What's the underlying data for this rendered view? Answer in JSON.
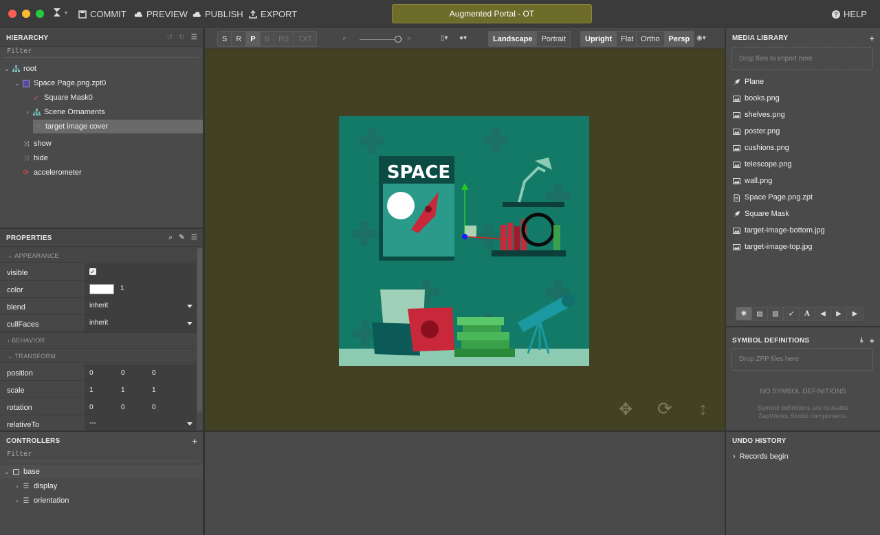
{
  "toolbar": {
    "commit": "COMMIT",
    "preview": "PREVIEW",
    "publish": "PUBLISH",
    "export": "EXPORT",
    "help": "HELP",
    "document_title": "Augmented Portal - OT"
  },
  "hierarchy": {
    "title": "HIERARCHY",
    "filter_placeholder": "Filter",
    "items": [
      {
        "label": "root",
        "icon": "hierarchy-icon"
      },
      {
        "label": "Space Page.png.zpt0",
        "icon": "page-icon"
      },
      {
        "label": "Square Mask0",
        "icon": "rocket-icon"
      },
      {
        "label": "Scene Ornaments",
        "icon": "hierarchy-icon"
      },
      {
        "label": "target image cover",
        "icon": "target-icon",
        "selected": true
      },
      {
        "label": "show",
        "icon": "shuffle-icon"
      },
      {
        "label": "hide",
        "icon": "shuffle-icon"
      },
      {
        "label": "accelerometer",
        "icon": "sync-icon"
      }
    ]
  },
  "properties": {
    "title": "PROPERTIES",
    "sections": {
      "appearance": "APPEARANCE",
      "behavior": "BEHAVIOR",
      "transform": "TRANSFORM"
    },
    "visible": {
      "label": "visible",
      "checked": true
    },
    "color": {
      "label": "color",
      "value": "1",
      "swatch": "#ffffff"
    },
    "blend": {
      "label": "blend",
      "value": "inherit"
    },
    "cullFaces": {
      "label": "cullFaces",
      "value": "inherit"
    },
    "position": {
      "label": "position",
      "values": [
        "0",
        "0",
        "0"
      ]
    },
    "scale": {
      "label": "scale",
      "values": [
        "1",
        "1",
        "1"
      ]
    },
    "rotation": {
      "label": "rotation",
      "values": [
        "0",
        "0",
        "0"
      ]
    },
    "relativeTo": {
      "label": "relativeTo",
      "value": "---"
    }
  },
  "controllers": {
    "title": "CONTROLLERS",
    "filter_placeholder": "Filter",
    "items": [
      {
        "label": "base"
      },
      {
        "label": "display"
      },
      {
        "label": "orientation"
      }
    ]
  },
  "viewport": {
    "modes": [
      "S",
      "R",
      "P",
      "B",
      "RS",
      "TXT"
    ],
    "active_mode": "P",
    "orientation": [
      "Landscape",
      "Portrait"
    ],
    "active_orientation": "Landscape",
    "facing": [
      "Upright",
      "Flat"
    ],
    "active_facing": "Upright",
    "projection": [
      "Ortho",
      "Persp"
    ],
    "active_projection": "Persp",
    "zoom": 0.9,
    "scene": {
      "poster_title": "SPACE",
      "background": "#137a68"
    }
  },
  "media": {
    "title": "MEDIA LIBRARY",
    "dropzone": "Drop files to import here",
    "items": [
      {
        "label": "Plane",
        "icon": "rocket-icon"
      },
      {
        "label": "books.png",
        "icon": "image-icon"
      },
      {
        "label": "shelves.png",
        "icon": "image-icon"
      },
      {
        "label": "poster.png",
        "icon": "image-icon"
      },
      {
        "label": "cushions.png",
        "icon": "image-icon"
      },
      {
        "label": "telescope.png",
        "icon": "image-icon"
      },
      {
        "label": "wall.png",
        "icon": "image-icon"
      },
      {
        "label": "Space Page.png.zpt",
        "icon": "page-icon"
      },
      {
        "label": "Square Mask",
        "icon": "rocket-icon"
      },
      {
        "label": "target-image-bottom.jpg",
        "icon": "image-icon"
      },
      {
        "label": "target-image-top.jpg",
        "icon": "image-icon"
      }
    ]
  },
  "symbols": {
    "title": "SYMBOL DEFINITIONS",
    "dropzone": "Drop ZPP files here",
    "empty_title": "NO SYMBOL DEFINITIONS",
    "empty_desc": "Symbol definitions are reusable ZapWorks Studio components."
  },
  "undo": {
    "title": "UNDO HISTORY",
    "items": [
      "Records begin"
    ]
  }
}
